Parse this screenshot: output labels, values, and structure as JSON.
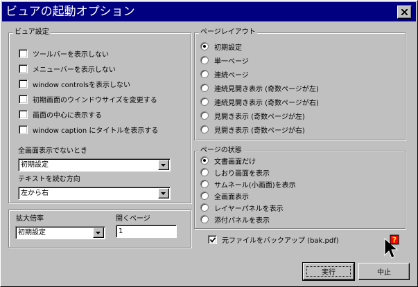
{
  "window": {
    "title": "ビュアの起動オプション"
  },
  "viewer": {
    "legend": "ビュア設定",
    "options": [
      {
        "label": "ツールバーを表示しない",
        "checked": false
      },
      {
        "label": "メニューバーを表示しない",
        "checked": false
      },
      {
        "label": "window controlsを表示しない",
        "checked": false
      },
      {
        "label": "初期画面のウインドウサイズを変更する",
        "checked": false
      },
      {
        "label": "画面の中心に表示する",
        "checked": false
      },
      {
        "label": "window caption にタイトルを表示する",
        "checked": false
      }
    ],
    "fullscreen_label": "全画面表示でないとき",
    "fullscreen_value": "初期設定",
    "direction_label": "テキストを読む方向",
    "direction_value": "左から右"
  },
  "zoom": {
    "label": "拡大倍率",
    "value": "初期設定"
  },
  "open_page": {
    "label": "開くページ",
    "value": "1"
  },
  "layout": {
    "legend": "ページレイアウト",
    "options": [
      {
        "label": "初期設定",
        "selected": true
      },
      {
        "label": "単一ページ",
        "selected": false
      },
      {
        "label": "連続ページ",
        "selected": false
      },
      {
        "label": "連続見開き表示 (奇数ページが左)",
        "selected": false
      },
      {
        "label": "連続見開き表示 (奇数ページが右)",
        "selected": false
      },
      {
        "label": "見開き表示 (奇数ページが左)",
        "selected": false
      },
      {
        "label": "見開き表示 (奇数ページが右)",
        "selected": false
      }
    ]
  },
  "page_state": {
    "legend": "ページの状態",
    "options": [
      {
        "label": "文書画面だけ",
        "selected": true
      },
      {
        "label": "しおり画面を表示",
        "selected": false
      },
      {
        "label": "サムネール(小画面)を表示",
        "selected": false
      },
      {
        "label": "全画面表示",
        "selected": false
      },
      {
        "label": "レイヤーパネルを表示",
        "selected": false
      },
      {
        "label": "添付パネルを表示",
        "selected": false
      }
    ]
  },
  "backup": {
    "label": "元ファイルをバックアップ (bak.pdf)",
    "checked": true
  },
  "buttons": {
    "ok": "実行",
    "cancel": "中止"
  },
  "icons": {
    "close": "close-icon",
    "help": "help-cursor-icon",
    "dropdown": "chevron-down-icon"
  },
  "colors": {
    "titlebar": "#000080",
    "face": "#c0c0c0",
    "help_badge": "#ff0000"
  }
}
